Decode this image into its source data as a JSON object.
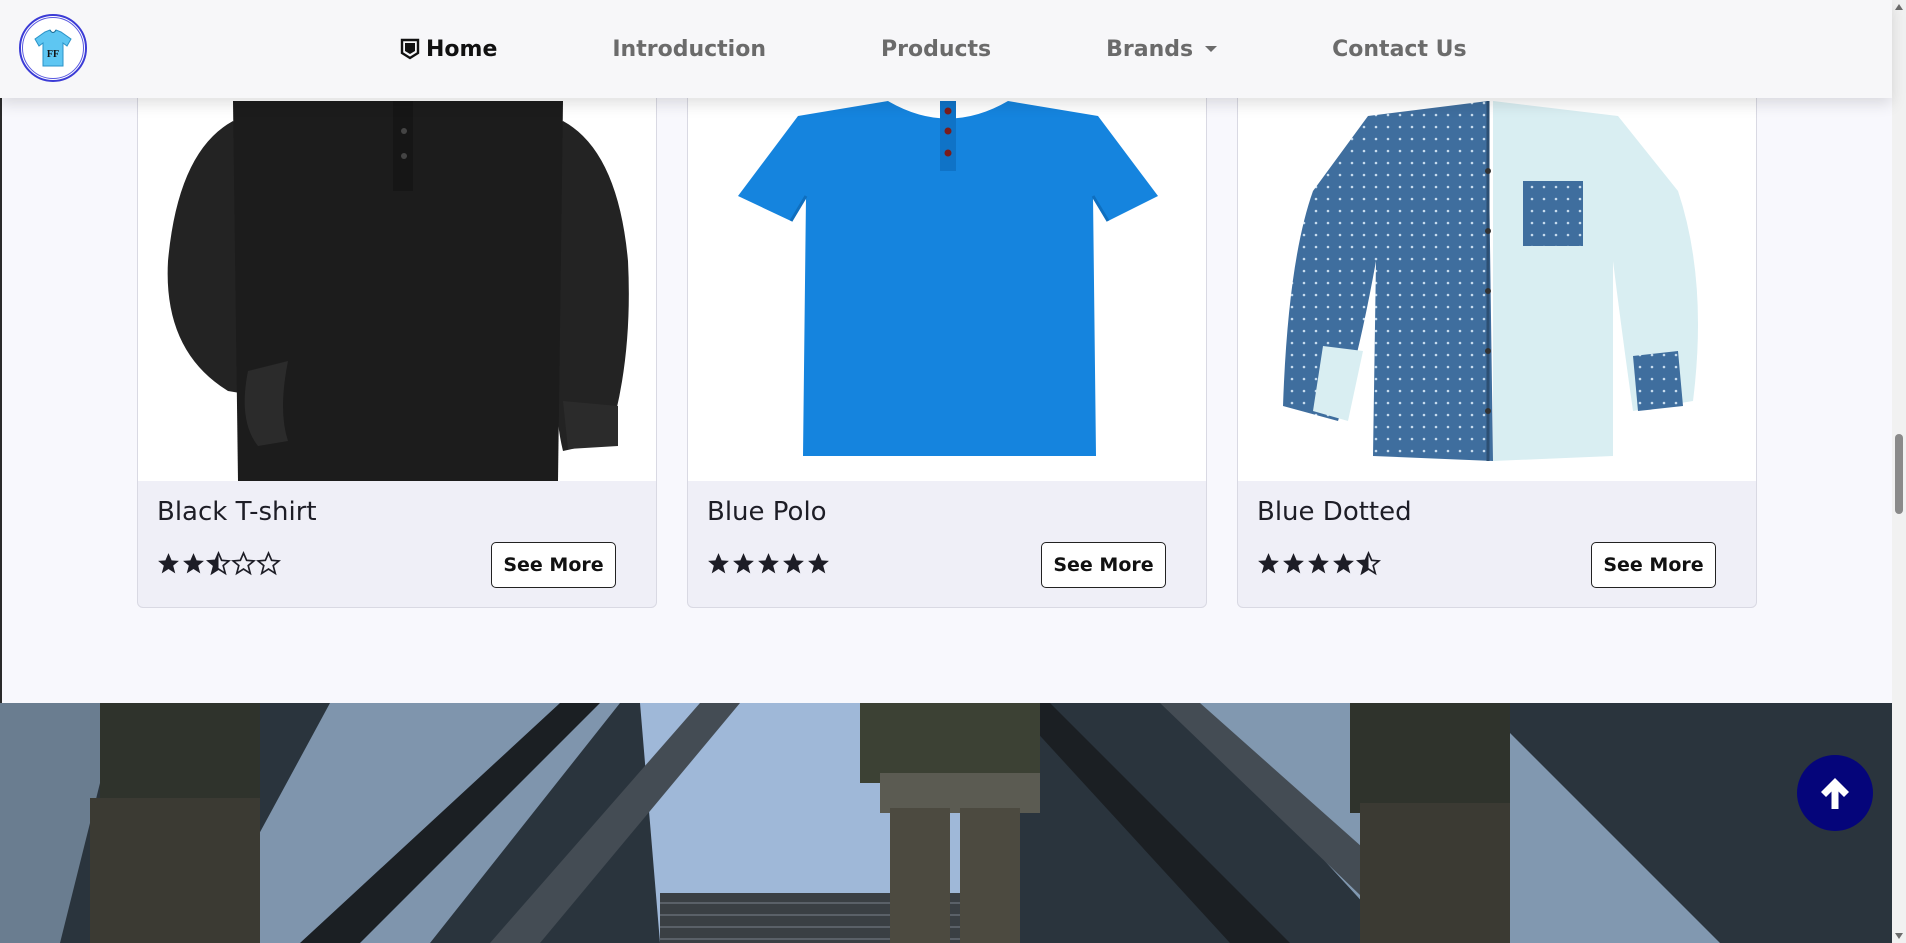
{
  "brand": {
    "logo_letters": "FF",
    "accent": "#3b3bd6"
  },
  "nav": {
    "items": [
      {
        "label": "Home",
        "icon": "home-icon",
        "active": true
      },
      {
        "label": "Introduction"
      },
      {
        "label": "Products"
      },
      {
        "label": "Brands",
        "dropdown": true
      },
      {
        "label": "Contact Us"
      }
    ]
  },
  "products": [
    {
      "title": "Black T-shirt",
      "rating": 2.5,
      "button": "See More",
      "image": "black-long-sleeve-shirt"
    },
    {
      "title": "Blue Polo",
      "rating": 5,
      "button": "See More",
      "image": "blue-polo-shirt"
    },
    {
      "title": "Blue Dotted",
      "rating": 4.5,
      "button": "See More",
      "image": "blue-dotted-shirt"
    }
  ],
  "banner": {
    "image": "escalator-photo"
  },
  "scroll_top": {
    "icon": "arrow-up-icon",
    "color": "#05057a"
  },
  "colors": {
    "card_bg": "#efeff7",
    "page_bg": "#f8f8fd",
    "star": "#1d1d26"
  }
}
